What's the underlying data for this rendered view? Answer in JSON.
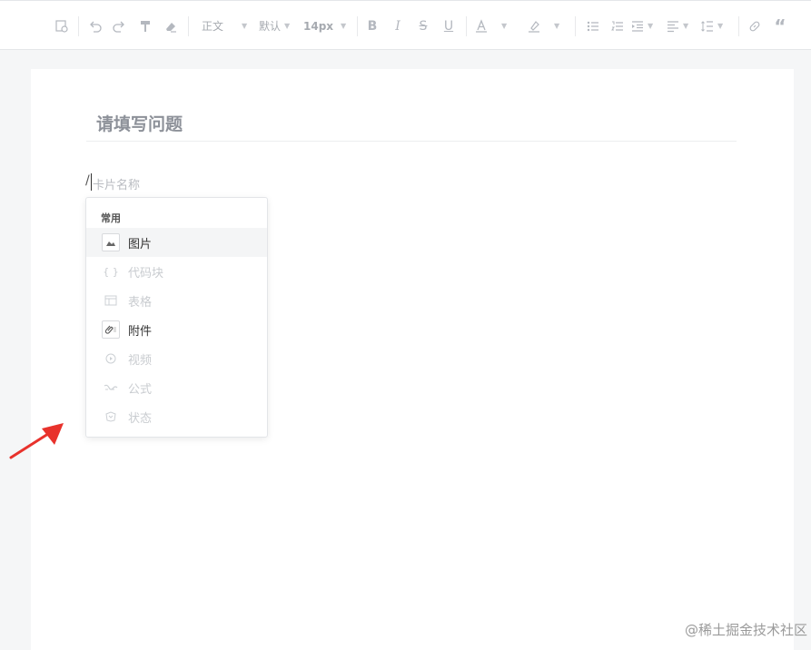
{
  "toolbar": {
    "paragraph_style": "正文",
    "font_family": "默认",
    "font_size": "14px",
    "icons": [
      "clear-format-icon",
      "undo-icon",
      "redo-icon",
      "format-painter-icon",
      "eraser-icon",
      "bold-icon",
      "italic-icon",
      "strikethrough-icon",
      "underline-icon",
      "font-color-icon",
      "highlight-icon",
      "bullet-list-icon",
      "ordered-list-icon",
      "indent-icon",
      "align-left-icon",
      "line-height-icon",
      "link-icon",
      "quote-icon"
    ]
  },
  "editor": {
    "title": "请填写问题",
    "slash": "/",
    "placeholder": "卡片名称"
  },
  "card_menu": {
    "section_label": "常用",
    "items": [
      {
        "label": "图片",
        "icon": "image-icon",
        "enabled": true
      },
      {
        "label": "代码块",
        "icon": "code-block-icon",
        "enabled": false
      },
      {
        "label": "表格",
        "icon": "table-icon",
        "enabled": false
      },
      {
        "label": "附件",
        "icon": "attachment-icon",
        "enabled": true
      },
      {
        "label": "视频",
        "icon": "video-icon",
        "enabled": false
      },
      {
        "label": "公式",
        "icon": "formula-icon",
        "enabled": false
      },
      {
        "label": "状态",
        "icon": "status-icon",
        "enabled": false
      }
    ]
  },
  "watermark": "@稀土掘金技术社区",
  "colors": {
    "annotation_arrow": "#e8322c",
    "page_background": "#f5f6f7",
    "toolbar_icon": "#b4b8bf"
  }
}
